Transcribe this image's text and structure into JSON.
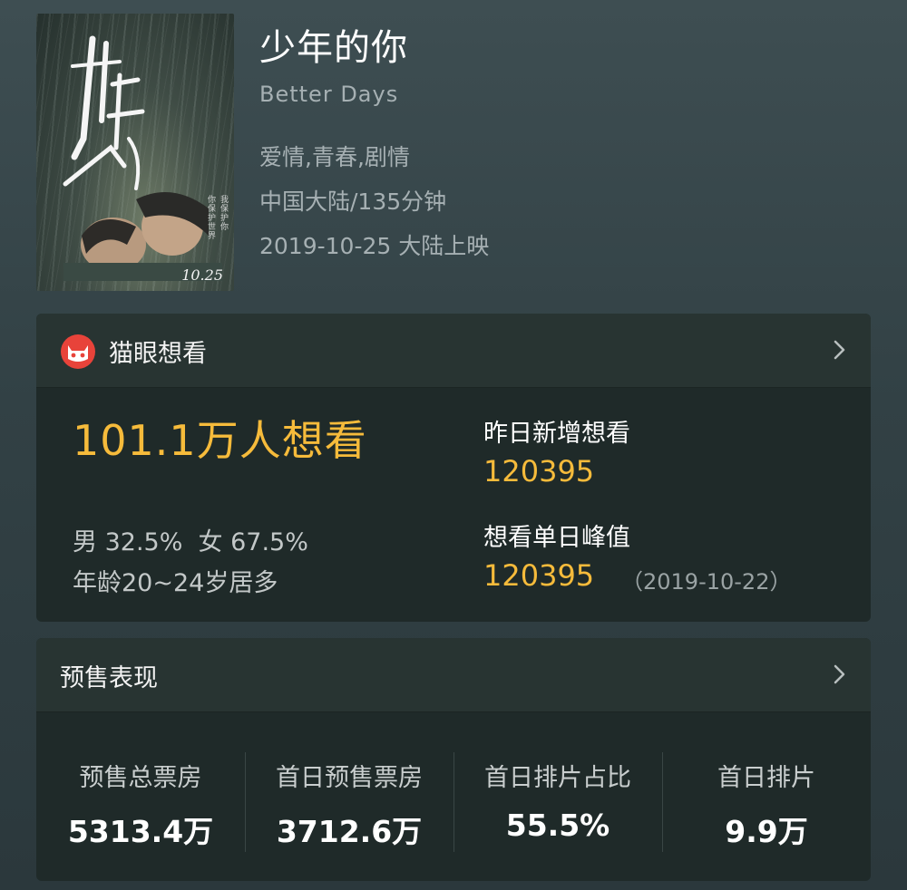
{
  "movie": {
    "title": "少年的你",
    "english_title": "Better Days",
    "genres": "爱情,青春,剧情",
    "region_duration": "中国大陆/135分钟",
    "release": "2019-10-25 大陆上映",
    "poster": {
      "date_text": "10.25",
      "calligraphy": "少年的你"
    }
  },
  "want_card": {
    "header_label": "猫眼想看",
    "total": "101.1万人想看",
    "gender": "男 32.5%  女 67.5%",
    "age": "年龄20~24岁居多",
    "yesterday_label": "昨日新增想看",
    "yesterday_value": "120395",
    "peak_label": "想看单日峰值",
    "peak_value": "120395",
    "peak_date": "（2019-10-22）"
  },
  "presale_card": {
    "header_label": "预售表现",
    "stats": [
      {
        "label": "预售总票房",
        "value": "5313.4万"
      },
      {
        "label": "首日预售票房",
        "value": "3712.6万"
      },
      {
        "label": "首日排片占比",
        "value": "55.5%"
      },
      {
        "label": "首日排片",
        "value": "9.9万"
      }
    ]
  },
  "colors": {
    "accent": "#f6bb3b",
    "logo_red": "#e8433a",
    "card_bg": "#1f2a29",
    "page_bg": "#36464a"
  },
  "icons": {
    "header_logo": "maoyan-cat-icon",
    "chevron": "chevron-right-icon"
  }
}
